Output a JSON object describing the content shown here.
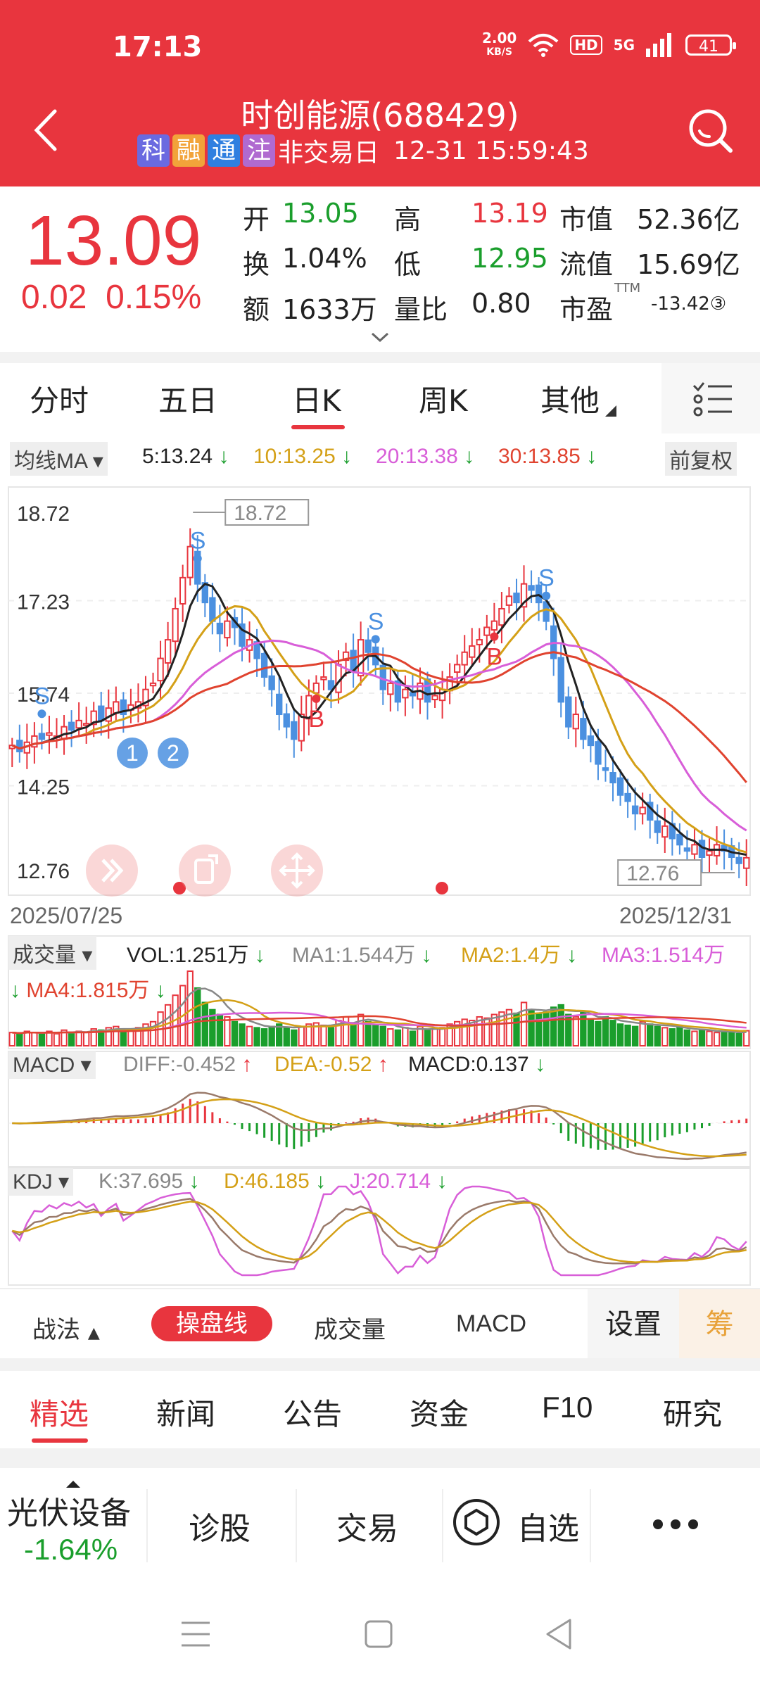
{
  "status": {
    "time": "17:13",
    "netspeed_value": "2.00",
    "netspeed_unit": "KB/S",
    "hd": "HD",
    "signal": "5G",
    "battery": "41"
  },
  "header": {
    "title": "时创能源(688429)",
    "tags": [
      {
        "text": "科",
        "color": "#6a6ae0"
      },
      {
        "text": "融",
        "color": "#f2a33a"
      },
      {
        "text": "通",
        "color": "#2f7fe0"
      },
      {
        "text": "注",
        "color": "#b06ad0"
      }
    ],
    "market_status": "非交易日",
    "datetime": "12-31 15:59:43"
  },
  "quote": {
    "price": "13.09",
    "change": "0.02",
    "change_pct": "0.15%",
    "open_label": "开",
    "open": "13.05",
    "high_label": "高",
    "high": "13.19",
    "mcap_label": "市值",
    "mcap": "52.36亿",
    "turnover_label": "换",
    "turnover": "1.04%",
    "low_label": "低",
    "low": "12.95",
    "float_label": "流值",
    "float": "15.69亿",
    "amount_label": "额",
    "amount": "1633万",
    "vr_label": "量比",
    "vr": "0.80",
    "pe_label": "市盈",
    "pe_sup": "TTM",
    "pe": "-13.42③"
  },
  "tabs": [
    {
      "label": "分时"
    },
    {
      "label": "五日"
    },
    {
      "label": "日K"
    },
    {
      "label": "周K"
    },
    {
      "label": "其他"
    }
  ],
  "ma_legend": {
    "selector": "均线MA",
    "ma5": "5:13.24",
    "ma10": "10:13.25",
    "ma20": "20:13.38",
    "ma30": "30:13.85",
    "adjust": "前复权"
  },
  "colors": {
    "red": "#e8353e",
    "green": "#1a9e2c",
    "blue": "#4b90e0",
    "ma5": "#222222",
    "ma10": "#d4a017",
    "ma20": "#d85ed8",
    "ma30": "#e0432f"
  },
  "chart_data": {
    "type": "candlestick",
    "y_ticks": [
      "18.72",
      "17.23",
      "15.74",
      "14.25",
      "12.76"
    ],
    "ylim": [
      12.76,
      18.72
    ],
    "x_start": "2025/07/25",
    "x_end": "2025/12/31",
    "max_label": "18.72",
    "min_label": "12.76",
    "markers": [
      {
        "text": "S",
        "type": "sell"
      },
      {
        "text": "S",
        "type": "sell"
      },
      {
        "text": "S",
        "type": "sell"
      },
      {
        "text": "S",
        "type": "sell"
      },
      {
        "text": "B",
        "type": "buy"
      },
      {
        "text": "B",
        "type": "buy"
      },
      {
        "text": "1",
        "type": "event"
      },
      {
        "text": "2",
        "type": "event"
      }
    ],
    "close": [
      14.9,
      14.8,
      14.95,
      15.05,
      15.0,
      15.1,
      15.05,
      15.2,
      15.15,
      15.3,
      15.25,
      15.45,
      15.3,
      15.5,
      15.6,
      15.4,
      15.55,
      15.6,
      15.8,
      15.9,
      16.3,
      16.6,
      17.1,
      17.6,
      18.1,
      17.5,
      17.2,
      16.9,
      16.7,
      16.9,
      16.8,
      16.5,
      16.6,
      16.3,
      16.0,
      15.8,
      15.4,
      15.2,
      15.0,
      15.4,
      15.7,
      15.9,
      16.0,
      15.8,
      16.2,
      16.4,
      16.1,
      16.6,
      16.4,
      16.2,
      15.8,
      15.9,
      15.6,
      15.8,
      15.7,
      15.9,
      15.6,
      15.7,
      15.8,
      16.0,
      16.2,
      16.4,
      16.5,
      16.6,
      16.8,
      16.9,
      17.1,
      17.3,
      17.2,
      17.5,
      17.4,
      17.2,
      16.9,
      16.3,
      15.6,
      15.2,
      15.4,
      15.0,
      14.9,
      14.6,
      14.5,
      14.3,
      14.1,
      14.0,
      13.8,
      13.9,
      13.7,
      13.5,
      13.6,
      13.4,
      13.3,
      13.2,
      13.3,
      13.1,
      13.2,
      13.3,
      13.2,
      13.1,
      13.0,
      13.09
    ],
    "volume": [
      1.1,
      1.0,
      1.2,
      1.1,
      1.0,
      1.2,
      1.0,
      1.3,
      1.1,
      1.2,
      1.1,
      1.4,
      1.3,
      1.5,
      1.6,
      1.2,
      1.4,
      1.5,
      1.8,
      2.0,
      2.8,
      3.4,
      4.2,
      5.0,
      6.2,
      4.8,
      3.6,
      3.0,
      2.6,
      2.4,
      2.0,
      1.8,
      1.6,
      1.5,
      1.4,
      1.6,
      1.8,
      1.5,
      1.3,
      1.6,
      1.8,
      1.9,
      1.7,
      1.5,
      2.1,
      2.4,
      1.8,
      2.6,
      2.0,
      1.7,
      1.6,
      1.4,
      1.3,
      1.5,
      1.2,
      1.6,
      1.3,
      1.4,
      1.5,
      1.8,
      2.0,
      2.2,
      2.1,
      2.4,
      2.3,
      2.6,
      2.8,
      3.0,
      2.7,
      3.6,
      3.0,
      2.6,
      2.8,
      3.2,
      3.4,
      2.6,
      2.4,
      2.8,
      2.2,
      2.0,
      2.4,
      2.1,
      1.8,
      1.7,
      1.6,
      2.0,
      1.8,
      1.6,
      1.5,
      1.4,
      1.6,
      1.3,
      1.2,
      1.3,
      1.2,
      1.1,
      1.2,
      1.1,
      1.0,
      1.25
    ],
    "indicators": {
      "vol_label": "成交量",
      "vol": "VOL:1.251万",
      "ma1": "MA1:1.544万",
      "ma2": "MA2:1.4万",
      "ma3": "MA3:1.514万",
      "ma4": "MA4:1.815万",
      "macd_label": "MACD",
      "diff": "DIFF:-0.452",
      "dea": "DEA:-0.52",
      "macd": "MACD:0.137",
      "kdj_label": "KDJ",
      "k": "K:37.695",
      "d": "D:46.185",
      "j": "J:20.714"
    }
  },
  "toolbar": {
    "strategy": "战法",
    "active": "操盘线",
    "volume": "成交量",
    "macd": "MACD",
    "settings": "设置",
    "chips": "筹"
  },
  "news_tabs": [
    {
      "label": "精选"
    },
    {
      "label": "新闻"
    },
    {
      "label": "公告"
    },
    {
      "label": "资金"
    },
    {
      "label": "F10"
    },
    {
      "label": "研究"
    }
  ],
  "action_bar": {
    "sector": "光伏设备",
    "sector_change": "-1.64%",
    "diagnose": "诊股",
    "trade": "交易",
    "watch": "自选"
  }
}
